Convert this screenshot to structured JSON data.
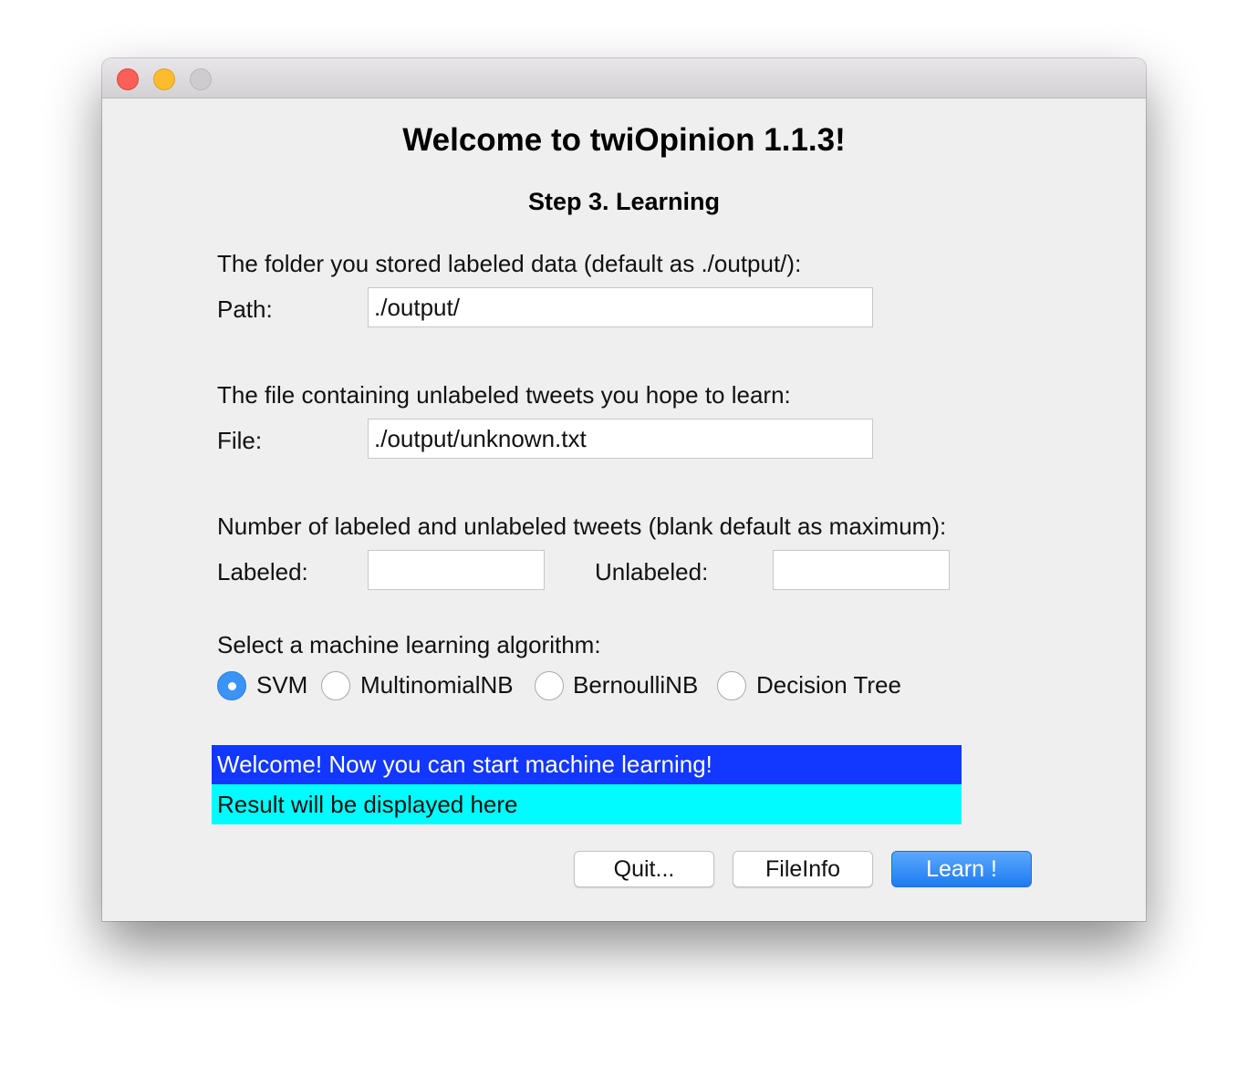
{
  "window": {
    "title_text": "Welcome to twiOpinion 1.1.3!",
    "step_text": "Step 3. Learning"
  },
  "folder_section": {
    "heading": "The folder you stored labeled data (default as ./output/):",
    "path_label": "Path:",
    "path_value": "./output/"
  },
  "file_section": {
    "heading": "The file containing unlabeled tweets you hope to learn:",
    "file_label": "File:",
    "file_value": "./output/unknown.txt"
  },
  "count_section": {
    "heading": "Number of labeled and unlabeled tweets (blank default as maximum):",
    "labeled_label": "Labeled:",
    "labeled_value": "",
    "unlabeled_label": "Unlabeled:",
    "unlabeled_value": ""
  },
  "algorithm_section": {
    "heading": "Select a machine learning algorithm:",
    "options": [
      {
        "label": "SVM",
        "selected": true
      },
      {
        "label": "MultinomialNB",
        "selected": false
      },
      {
        "label": "BernoulliNB",
        "selected": false
      },
      {
        "label": "Decision Tree",
        "selected": false
      }
    ]
  },
  "status": {
    "message": "Welcome! Now you can start machine learning!",
    "result": "Result will be displayed here",
    "message_bg": "#1237ff",
    "result_bg": "#00fcff"
  },
  "buttons": {
    "quit": "Quit...",
    "fileinfo": "FileInfo",
    "learn": "Learn !"
  },
  "colors": {
    "accent": "#3b94f4",
    "close_light": "#fc5f57",
    "minimize_light": "#fdbc2e",
    "zoom_light": "#cdcdcd"
  }
}
